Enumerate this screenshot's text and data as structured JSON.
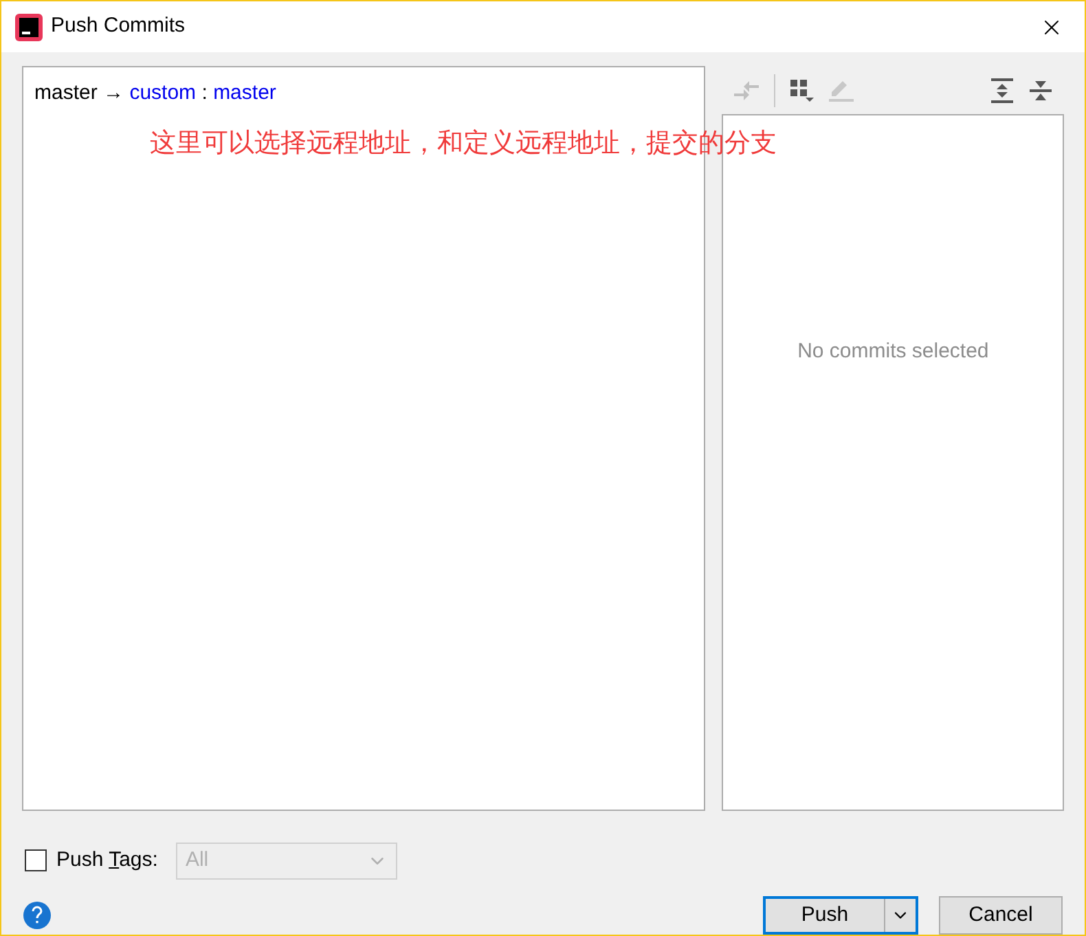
{
  "window": {
    "title": "Push Commits"
  },
  "push_spec": {
    "local_branch": "master",
    "arrow": "→",
    "remote": "custom",
    "separator": ":",
    "remote_branch": "master"
  },
  "annotation": "这里可以选择远程地址，和定义远程地址，提交的分支",
  "commit_details": {
    "empty_text": "No commits selected"
  },
  "push_tags": {
    "checked": false,
    "label_before": "Push ",
    "mnemonic": "T",
    "label_after": "ags:",
    "dropdown": {
      "value": "All",
      "disabled": true
    }
  },
  "buttons": [
    {
      "kind": "split",
      "label": "Push",
      "default": true
    },
    {
      "kind": "plain",
      "label": "Cancel",
      "default": false
    }
  ]
}
